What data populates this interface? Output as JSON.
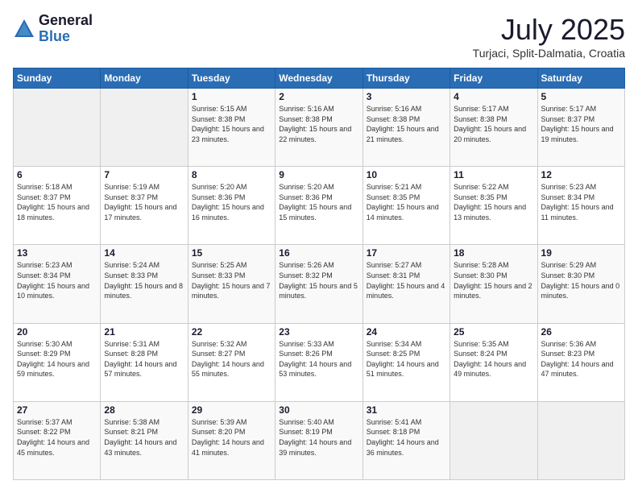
{
  "logo": {
    "general": "General",
    "blue": "Blue"
  },
  "header": {
    "month_year": "July 2025",
    "location": "Turjaci, Split-Dalmatia, Croatia"
  },
  "weekdays": [
    "Sunday",
    "Monday",
    "Tuesday",
    "Wednesday",
    "Thursday",
    "Friday",
    "Saturday"
  ],
  "weeks": [
    [
      {
        "day": "",
        "sunrise": "",
        "sunset": "",
        "daylight": ""
      },
      {
        "day": "",
        "sunrise": "",
        "sunset": "",
        "daylight": ""
      },
      {
        "day": "1",
        "sunrise": "Sunrise: 5:15 AM",
        "sunset": "Sunset: 8:38 PM",
        "daylight": "Daylight: 15 hours and 23 minutes."
      },
      {
        "day": "2",
        "sunrise": "Sunrise: 5:16 AM",
        "sunset": "Sunset: 8:38 PM",
        "daylight": "Daylight: 15 hours and 22 minutes."
      },
      {
        "day": "3",
        "sunrise": "Sunrise: 5:16 AM",
        "sunset": "Sunset: 8:38 PM",
        "daylight": "Daylight: 15 hours and 21 minutes."
      },
      {
        "day": "4",
        "sunrise": "Sunrise: 5:17 AM",
        "sunset": "Sunset: 8:38 PM",
        "daylight": "Daylight: 15 hours and 20 minutes."
      },
      {
        "day": "5",
        "sunrise": "Sunrise: 5:17 AM",
        "sunset": "Sunset: 8:37 PM",
        "daylight": "Daylight: 15 hours and 19 minutes."
      }
    ],
    [
      {
        "day": "6",
        "sunrise": "Sunrise: 5:18 AM",
        "sunset": "Sunset: 8:37 PM",
        "daylight": "Daylight: 15 hours and 18 minutes."
      },
      {
        "day": "7",
        "sunrise": "Sunrise: 5:19 AM",
        "sunset": "Sunset: 8:37 PM",
        "daylight": "Daylight: 15 hours and 17 minutes."
      },
      {
        "day": "8",
        "sunrise": "Sunrise: 5:20 AM",
        "sunset": "Sunset: 8:36 PM",
        "daylight": "Daylight: 15 hours and 16 minutes."
      },
      {
        "day": "9",
        "sunrise": "Sunrise: 5:20 AM",
        "sunset": "Sunset: 8:36 PM",
        "daylight": "Daylight: 15 hours and 15 minutes."
      },
      {
        "day": "10",
        "sunrise": "Sunrise: 5:21 AM",
        "sunset": "Sunset: 8:35 PM",
        "daylight": "Daylight: 15 hours and 14 minutes."
      },
      {
        "day": "11",
        "sunrise": "Sunrise: 5:22 AM",
        "sunset": "Sunset: 8:35 PM",
        "daylight": "Daylight: 15 hours and 13 minutes."
      },
      {
        "day": "12",
        "sunrise": "Sunrise: 5:23 AM",
        "sunset": "Sunset: 8:34 PM",
        "daylight": "Daylight: 15 hours and 11 minutes."
      }
    ],
    [
      {
        "day": "13",
        "sunrise": "Sunrise: 5:23 AM",
        "sunset": "Sunset: 8:34 PM",
        "daylight": "Daylight: 15 hours and 10 minutes."
      },
      {
        "day": "14",
        "sunrise": "Sunrise: 5:24 AM",
        "sunset": "Sunset: 8:33 PM",
        "daylight": "Daylight: 15 hours and 8 minutes."
      },
      {
        "day": "15",
        "sunrise": "Sunrise: 5:25 AM",
        "sunset": "Sunset: 8:33 PM",
        "daylight": "Daylight: 15 hours and 7 minutes."
      },
      {
        "day": "16",
        "sunrise": "Sunrise: 5:26 AM",
        "sunset": "Sunset: 8:32 PM",
        "daylight": "Daylight: 15 hours and 5 minutes."
      },
      {
        "day": "17",
        "sunrise": "Sunrise: 5:27 AM",
        "sunset": "Sunset: 8:31 PM",
        "daylight": "Daylight: 15 hours and 4 minutes."
      },
      {
        "day": "18",
        "sunrise": "Sunrise: 5:28 AM",
        "sunset": "Sunset: 8:30 PM",
        "daylight": "Daylight: 15 hours and 2 minutes."
      },
      {
        "day": "19",
        "sunrise": "Sunrise: 5:29 AM",
        "sunset": "Sunset: 8:30 PM",
        "daylight": "Daylight: 15 hours and 0 minutes."
      }
    ],
    [
      {
        "day": "20",
        "sunrise": "Sunrise: 5:30 AM",
        "sunset": "Sunset: 8:29 PM",
        "daylight": "Daylight: 14 hours and 59 minutes."
      },
      {
        "day": "21",
        "sunrise": "Sunrise: 5:31 AM",
        "sunset": "Sunset: 8:28 PM",
        "daylight": "Daylight: 14 hours and 57 minutes."
      },
      {
        "day": "22",
        "sunrise": "Sunrise: 5:32 AM",
        "sunset": "Sunset: 8:27 PM",
        "daylight": "Daylight: 14 hours and 55 minutes."
      },
      {
        "day": "23",
        "sunrise": "Sunrise: 5:33 AM",
        "sunset": "Sunset: 8:26 PM",
        "daylight": "Daylight: 14 hours and 53 minutes."
      },
      {
        "day": "24",
        "sunrise": "Sunrise: 5:34 AM",
        "sunset": "Sunset: 8:25 PM",
        "daylight": "Daylight: 14 hours and 51 minutes."
      },
      {
        "day": "25",
        "sunrise": "Sunrise: 5:35 AM",
        "sunset": "Sunset: 8:24 PM",
        "daylight": "Daylight: 14 hours and 49 minutes."
      },
      {
        "day": "26",
        "sunrise": "Sunrise: 5:36 AM",
        "sunset": "Sunset: 8:23 PM",
        "daylight": "Daylight: 14 hours and 47 minutes."
      }
    ],
    [
      {
        "day": "27",
        "sunrise": "Sunrise: 5:37 AM",
        "sunset": "Sunset: 8:22 PM",
        "daylight": "Daylight: 14 hours and 45 minutes."
      },
      {
        "day": "28",
        "sunrise": "Sunrise: 5:38 AM",
        "sunset": "Sunset: 8:21 PM",
        "daylight": "Daylight: 14 hours and 43 minutes."
      },
      {
        "day": "29",
        "sunrise": "Sunrise: 5:39 AM",
        "sunset": "Sunset: 8:20 PM",
        "daylight": "Daylight: 14 hours and 41 minutes."
      },
      {
        "day": "30",
        "sunrise": "Sunrise: 5:40 AM",
        "sunset": "Sunset: 8:19 PM",
        "daylight": "Daylight: 14 hours and 39 minutes."
      },
      {
        "day": "31",
        "sunrise": "Sunrise: 5:41 AM",
        "sunset": "Sunset: 8:18 PM",
        "daylight": "Daylight: 14 hours and 36 minutes."
      },
      {
        "day": "",
        "sunrise": "",
        "sunset": "",
        "daylight": ""
      },
      {
        "day": "",
        "sunrise": "",
        "sunset": "",
        "daylight": ""
      }
    ]
  ]
}
